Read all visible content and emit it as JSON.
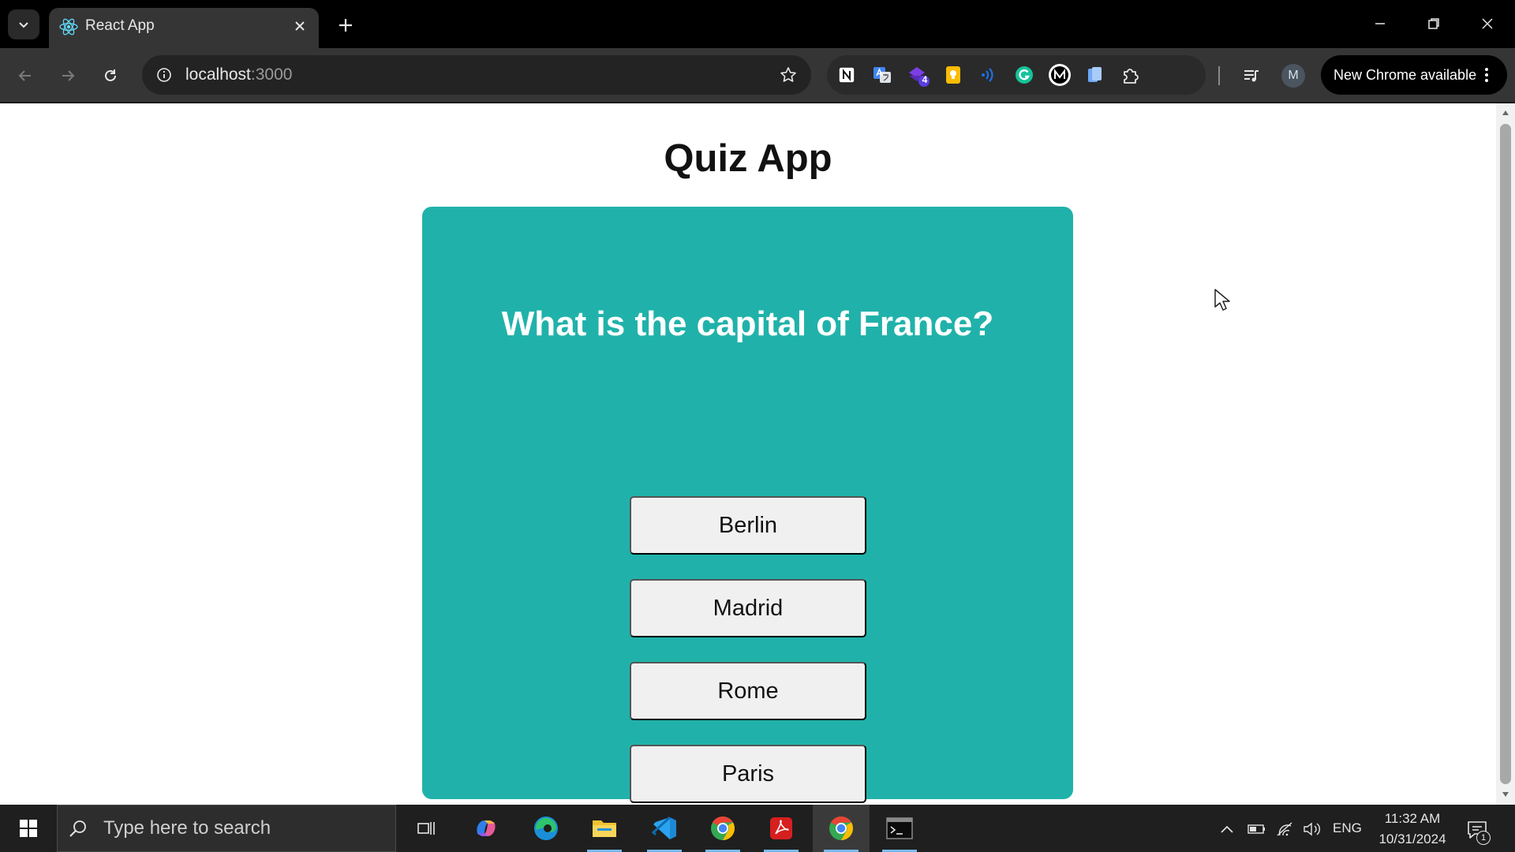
{
  "browser": {
    "tab_title": "React App",
    "url_host": "localhost",
    "url_port": ":3000",
    "profile_initial": "M",
    "update_label": "New Chrome available",
    "extension_badge": "4"
  },
  "page": {
    "title": "Quiz App",
    "question": "What is the capital of France?",
    "answers": [
      "Berlin",
      "Madrid",
      "Rome",
      "Paris"
    ],
    "card_color": "#20b2aa"
  },
  "taskbar": {
    "search_placeholder": "Type here to search",
    "language": "ENG",
    "time": "11:32 AM",
    "date": "10/31/2024",
    "notification_count": "1"
  }
}
